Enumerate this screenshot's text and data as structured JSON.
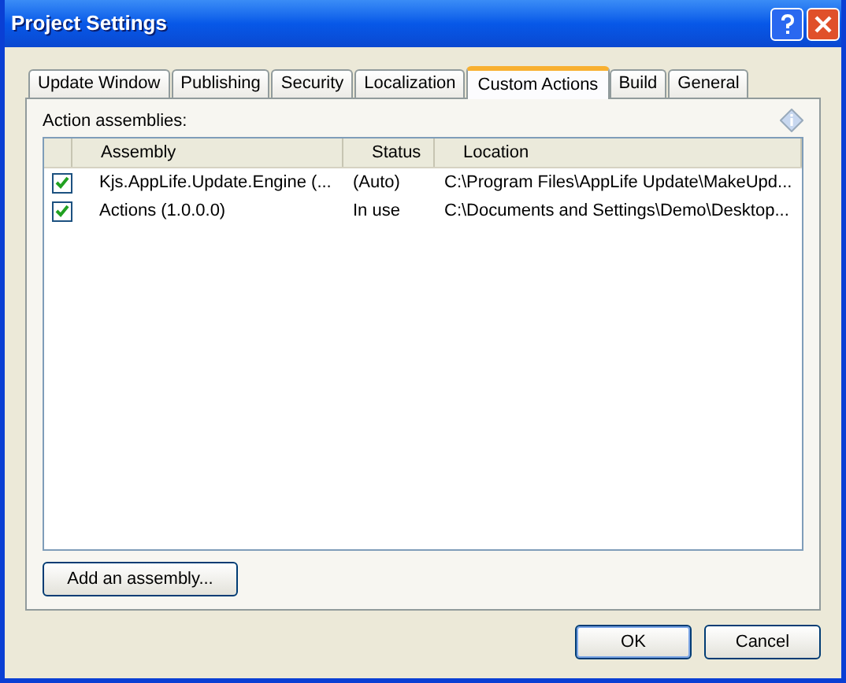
{
  "window": {
    "title": "Project Settings"
  },
  "tabs": [
    {
      "label": "Update Window",
      "selected": false
    },
    {
      "label": "Publishing",
      "selected": false
    },
    {
      "label": "Security",
      "selected": false
    },
    {
      "label": "Localization",
      "selected": false
    },
    {
      "label": "Custom Actions",
      "selected": true
    },
    {
      "label": "Build",
      "selected": false
    },
    {
      "label": "General",
      "selected": false
    }
  ],
  "section_label": "Action assemblies:",
  "table": {
    "columns": [
      "Assembly",
      "Status",
      "Location"
    ],
    "rows": [
      {
        "checked": true,
        "cells": [
          "Kjs.AppLife.Update.Engine (...",
          "(Auto)",
          "C:\\Program Files\\AppLife Update\\MakeUpd..."
        ]
      },
      {
        "checked": true,
        "cells": [
          "Actions (1.0.0.0)",
          "In use",
          "C:\\Documents and Settings\\Demo\\Desktop..."
        ]
      }
    ]
  },
  "add_button": "Add an assembly...",
  "buttons": [
    "OK",
    "Cancel"
  ]
}
